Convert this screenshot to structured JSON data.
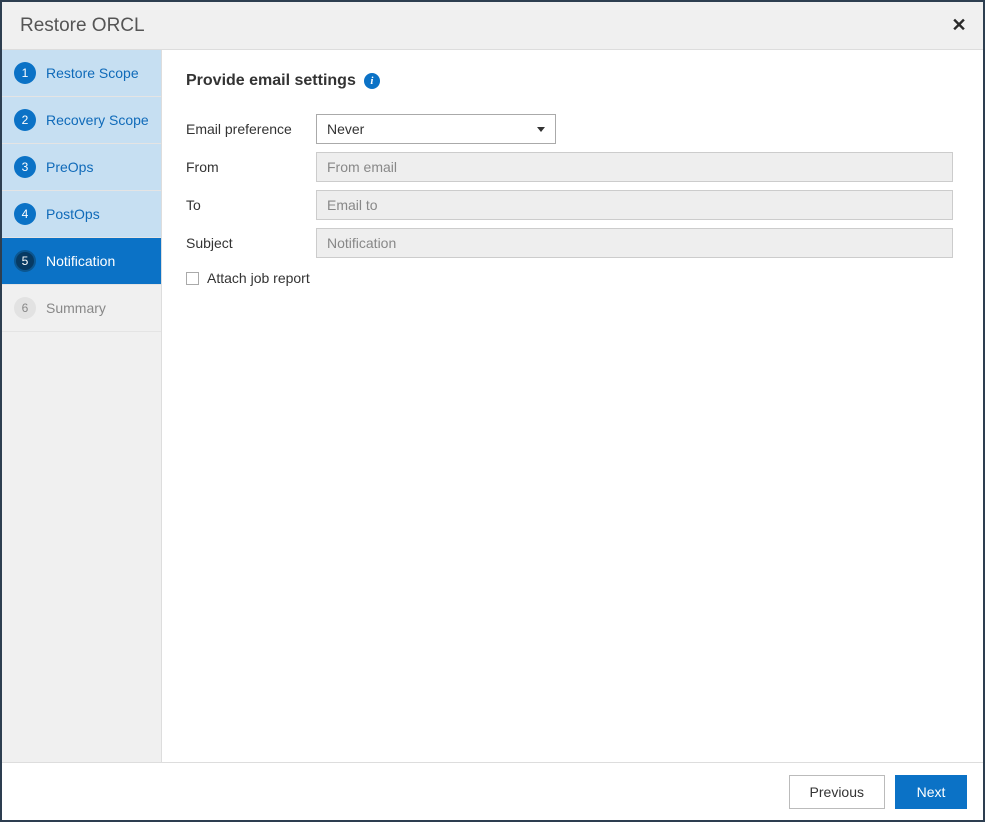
{
  "header": {
    "title": "Restore ORCL"
  },
  "sidebar": {
    "steps": [
      {
        "num": "1",
        "label": "Restore Scope",
        "state": "completed"
      },
      {
        "num": "2",
        "label": "Recovery Scope",
        "state": "completed"
      },
      {
        "num": "3",
        "label": "PreOps",
        "state": "completed"
      },
      {
        "num": "4",
        "label": "PostOps",
        "state": "completed"
      },
      {
        "num": "5",
        "label": "Notification",
        "state": "active"
      },
      {
        "num": "6",
        "label": "Summary",
        "state": "pending"
      }
    ]
  },
  "main": {
    "section_title": "Provide email settings",
    "fields": {
      "email_preference": {
        "label": "Email preference",
        "value": "Never"
      },
      "from": {
        "label": "From",
        "value": "",
        "placeholder": "From email"
      },
      "to": {
        "label": "To",
        "value": "",
        "placeholder": "Email to"
      },
      "subject": {
        "label": "Subject",
        "value": "",
        "placeholder": "Notification"
      }
    },
    "attach_checkbox": {
      "label": "Attach job report",
      "checked": false
    }
  },
  "footer": {
    "previous": "Previous",
    "next": "Next"
  }
}
